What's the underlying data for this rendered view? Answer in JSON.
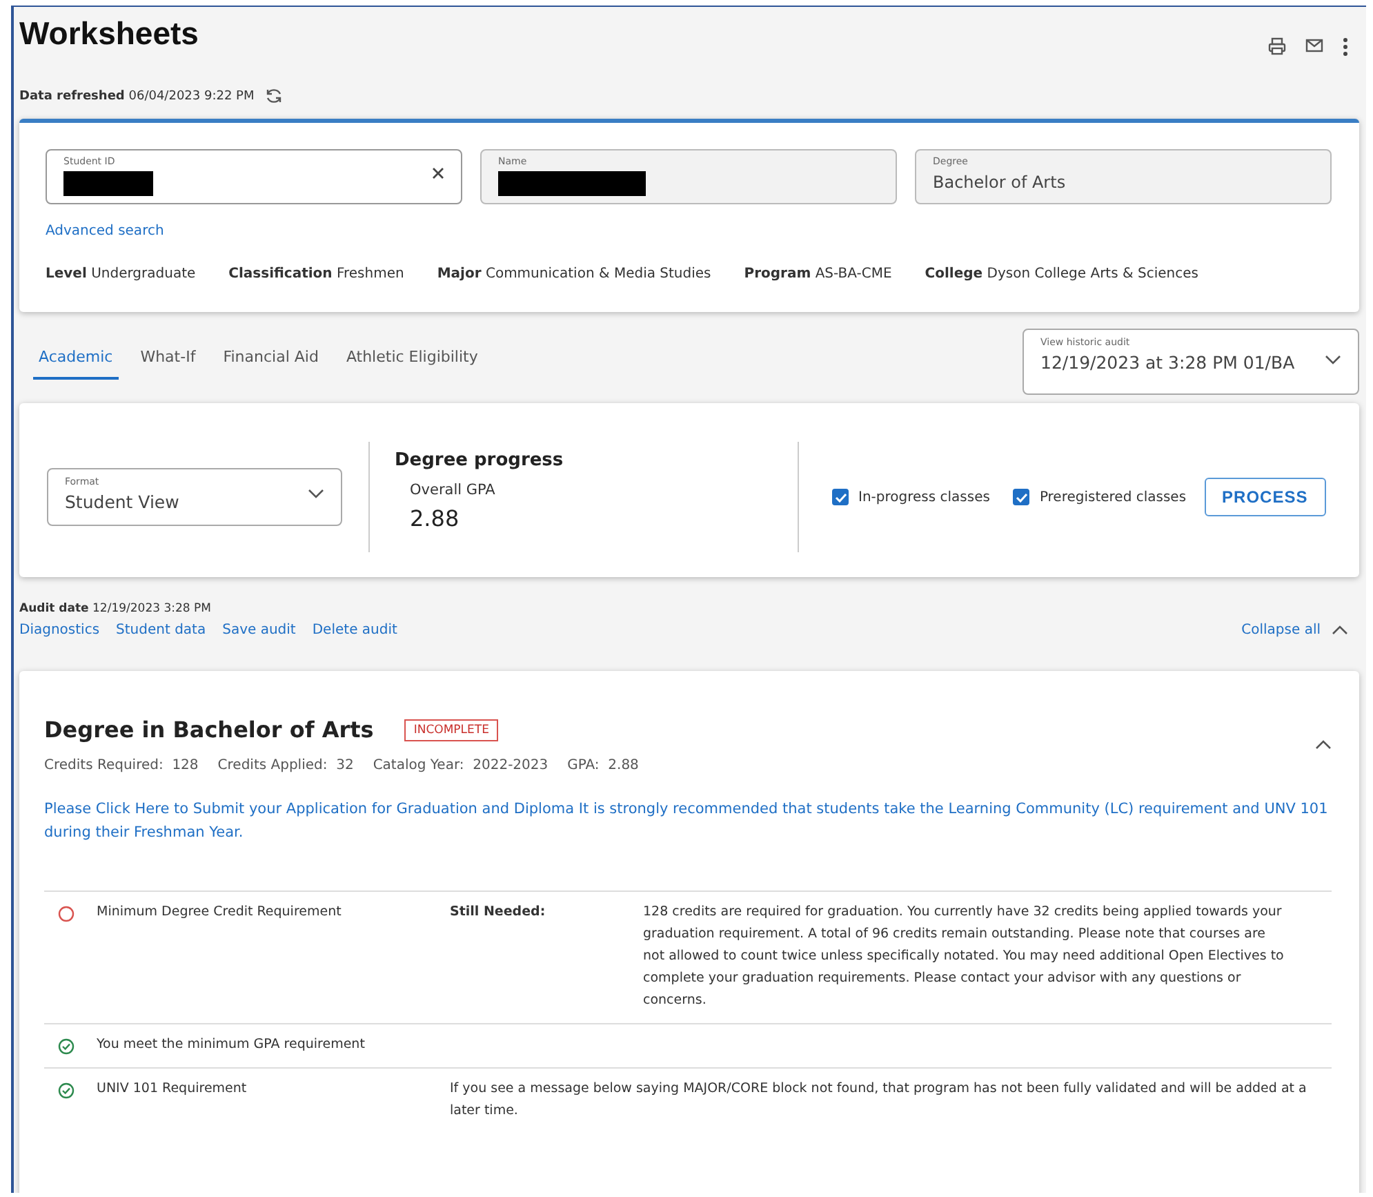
{
  "page": {
    "title": "Worksheets",
    "refreshed_label": "Data refreshed",
    "refreshed_value": "06/04/2023 9:22 PM"
  },
  "student": {
    "fields": [
      {
        "kind": "clearable",
        "label": "Student ID",
        "redacted": true
      },
      {
        "kind": "readonly",
        "label": "Name",
        "redacted": true
      },
      {
        "kind": "readonly",
        "label": "Degree",
        "value": "Bachelor of Arts"
      }
    ],
    "advanced_search": "Advanced search",
    "info": [
      {
        "label": "Level",
        "value": "Undergraduate"
      },
      {
        "label": "Classification",
        "value": "Freshmen"
      },
      {
        "label": "Major",
        "value": "Communication & Media Studies"
      },
      {
        "label": "Program",
        "value": "AS-BA-CME"
      },
      {
        "label": "College",
        "value": "Dyson College Arts & Sciences"
      }
    ]
  },
  "tabs": [
    {
      "label": "Academic",
      "selected": true
    },
    {
      "label": "What-If",
      "selected": false
    },
    {
      "label": "Financial Aid",
      "selected": false
    },
    {
      "label": "Athletic Eligibility",
      "selected": false
    }
  ],
  "historic_audit": {
    "label": "View historic audit",
    "value": "12/19/2023 at 3:28 PM 01/BA"
  },
  "options": {
    "format": {
      "label": "Format",
      "value": "Student View"
    },
    "progress_title": "Degree progress",
    "gpa_label": "Overall GPA",
    "gpa_value": "2.88",
    "checkboxes": [
      {
        "label": "In-progress classes",
        "checked": true
      },
      {
        "label": "Preregistered classes",
        "checked": true
      }
    ],
    "process_button": "PROCESS"
  },
  "audit": {
    "date_label": "Audit date",
    "date_value": "12/19/2023 3:28 PM",
    "links": [
      "Diagnostics",
      "Student data",
      "Save audit",
      "Delete audit"
    ],
    "collapse_all": "Collapse all"
  },
  "block": {
    "title": "Degree in Bachelor of Arts",
    "status": "INCOMPLETE",
    "expanded": true,
    "facts": [
      {
        "label": "Credits Required:",
        "value": "128"
      },
      {
        "label": "Credits Applied:",
        "value": "32"
      },
      {
        "label": "Catalog Year:",
        "value": "2022-2023"
      },
      {
        "label": "GPA:",
        "value": "2.88"
      }
    ],
    "notice": "Please Click Here to Submit your Application for Graduation and Diploma It is strongly recommended that students take the Learning Community (LC) requirement and UNV 101 during their Freshman Year.",
    "requirements": [
      {
        "kind": "unmet",
        "label": "Minimum Degree Credit Requirement",
        "needed": "Still Needed:",
        "description": "128 credits are required for graduation. You currently have 32 credits being applied towards your graduation requirement. A total of 96 credits remain outstanding. Please note that courses are not allowed to count twice unless specifically notated. You may need additional Open Electives to complete your graduation requirements. Please contact your advisor with any questions or concerns."
      },
      {
        "kind": "met",
        "label": "You meet the minimum GPA requirement"
      },
      {
        "kind": "met",
        "label": "UNIV 101 Requirement",
        "description": "If you see a message below saying MAJOR/CORE block not found, that program has not been fully validated and will be added at a later time."
      }
    ]
  }
}
